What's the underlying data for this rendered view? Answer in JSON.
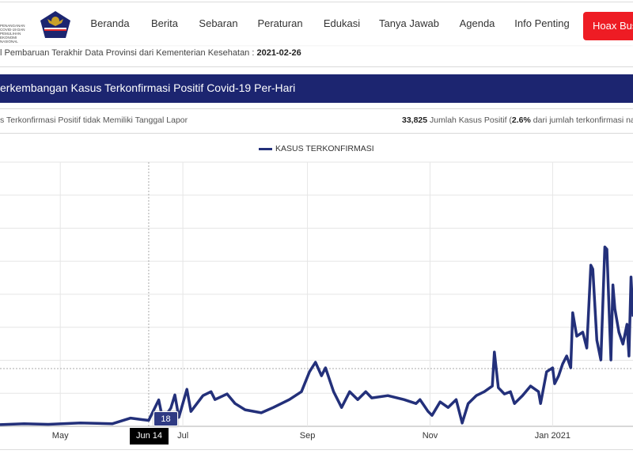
{
  "header": {
    "logo_text": [
      "PENANGANAN",
      "COVID-19 DAN PEMULIHAN",
      "EKONOMI NASIONAL"
    ],
    "nav": [
      {
        "label": "Beranda",
        "x": 139
      },
      {
        "label": "Berita"
      },
      {
        "label": "Sebaran"
      },
      {
        "label": "Peraturan"
      },
      {
        "label": "Edukasi"
      },
      {
        "label": "Tanya Jawab"
      },
      {
        "label": "Agenda"
      },
      {
        "label": "Info Penting"
      }
    ],
    "hoax_label": "Hoax Buster",
    "hoax_color": "#ee1c24"
  },
  "update": {
    "label": "l Pembaruan Terakhir Data Provinsi dari Kementerian Kesehatan : ",
    "date": "2021-02-26"
  },
  "banner": {
    "title": "erkembangan Kasus Terkonfirmasi Positif Covid-19 Per-Hari",
    "color": "#1c2570"
  },
  "info": {
    "left": "s Terkonfirmasi Positif tidak Memiliki Tanggal Lapor",
    "count": "33,825",
    "mid": " Jumlah Kasus Positif (",
    "pct": "2.6%",
    "rest": " dari jumlah terkonfirmasi na"
  },
  "chart_data": {
    "type": "line",
    "series": [
      {
        "name": "KASUS TERKONFIRMASI",
        "color": "#23307a",
        "points": [
          [
            "2020-04-01",
            5
          ],
          [
            "2020-04-13",
            8
          ],
          [
            "2020-04-25",
            6
          ],
          [
            "2020-05-11",
            10
          ],
          [
            "2020-05-27",
            8
          ],
          [
            "2020-06-05",
            25
          ],
          [
            "2020-06-11",
            20
          ],
          [
            "2020-06-14",
            18
          ],
          [
            "2020-06-19",
            80
          ],
          [
            "2020-06-21",
            20
          ],
          [
            "2020-06-25",
            55
          ],
          [
            "2020-06-27",
            95
          ],
          [
            "2020-06-29",
            27
          ],
          [
            "2020-07-03",
            112
          ],
          [
            "2020-07-05",
            45
          ],
          [
            "2020-07-11",
            93
          ],
          [
            "2020-07-15",
            105
          ],
          [
            "2020-07-17",
            81
          ],
          [
            "2020-07-23",
            98
          ],
          [
            "2020-07-27",
            69
          ],
          [
            "2020-08-01",
            50
          ],
          [
            "2020-08-09",
            41
          ],
          [
            "2020-08-15",
            57
          ],
          [
            "2020-08-23",
            81
          ],
          [
            "2020-08-29",
            105
          ],
          [
            "2020-09-02",
            165
          ],
          [
            "2020-09-05",
            194
          ],
          [
            "2020-09-08",
            153
          ],
          [
            "2020-09-10",
            177
          ],
          [
            "2020-09-14",
            105
          ],
          [
            "2020-09-18",
            57
          ],
          [
            "2020-09-22",
            105
          ],
          [
            "2020-09-26",
            81
          ],
          [
            "2020-09-30",
            105
          ],
          [
            "2020-10-03",
            86
          ],
          [
            "2020-10-11",
            93
          ],
          [
            "2020-10-19",
            81
          ],
          [
            "2020-10-25",
            69
          ],
          [
            "2020-10-27",
            81
          ],
          [
            "2020-10-31",
            45
          ],
          [
            "2020-11-02",
            33
          ],
          [
            "2020-11-06",
            74
          ],
          [
            "2020-11-10",
            57
          ],
          [
            "2020-11-14",
            81
          ],
          [
            "2020-11-17",
            10
          ],
          [
            "2020-11-20",
            69
          ],
          [
            "2020-11-24",
            93
          ],
          [
            "2020-11-28",
            105
          ],
          [
            "2020-12-02",
            122
          ],
          [
            "2020-12-03",
            225
          ],
          [
            "2020-12-05",
            117
          ],
          [
            "2020-12-08",
            98
          ],
          [
            "2020-12-11",
            105
          ],
          [
            "2020-12-13",
            69
          ],
          [
            "2020-12-17",
            93
          ],
          [
            "2020-12-21",
            122
          ],
          [
            "2020-12-25",
            105
          ],
          [
            "2020-12-26",
            69
          ],
          [
            "2020-12-29",
            165
          ],
          [
            "2021-01-01",
            177
          ],
          [
            "2021-01-02",
            129
          ],
          [
            "2021-01-04",
            153
          ],
          [
            "2021-01-06",
            189
          ],
          [
            "2021-01-08",
            213
          ],
          [
            "2021-01-10",
            177
          ],
          [
            "2021-01-11",
            344
          ],
          [
            "2021-01-13",
            273
          ],
          [
            "2021-01-16",
            285
          ],
          [
            "2021-01-18",
            237
          ],
          [
            "2021-01-20",
            488
          ],
          [
            "2021-01-21",
            476
          ],
          [
            "2021-01-23",
            261
          ],
          [
            "2021-01-25",
            201
          ],
          [
            "2021-01-27",
            543
          ],
          [
            "2021-01-28",
            536
          ],
          [
            "2021-01-30",
            201
          ],
          [
            "2021-01-31",
            428
          ],
          [
            "2021-02-01",
            356
          ],
          [
            "2021-02-03",
            285
          ],
          [
            "2021-02-05",
            249
          ],
          [
            "2021-02-07",
            309
          ],
          [
            "2021-02-08",
            213
          ],
          [
            "2021-02-09",
            452
          ],
          [
            "2021-02-10",
            332
          ]
        ]
      }
    ],
    "xlim": [
      "2020-04-01",
      "2021-02-10"
    ],
    "ylim": [
      0,
      800
    ],
    "ygrid_step": 100,
    "x_ticks": [
      {
        "date": "2020-05-01",
        "label": "May"
      },
      {
        "date": "2020-07-01",
        "label": "Jul"
      },
      {
        "date": "2020-09-01",
        "label": "Sep"
      },
      {
        "date": "2020-11-01",
        "label": "Nov"
      },
      {
        "date": "2021-01-01",
        "label": "Jan 2021"
      }
    ],
    "grid": true,
    "legend": "top-center",
    "tooltip": {
      "date": "2020-06-14",
      "date_label": "Jun 14",
      "value": "18"
    }
  }
}
